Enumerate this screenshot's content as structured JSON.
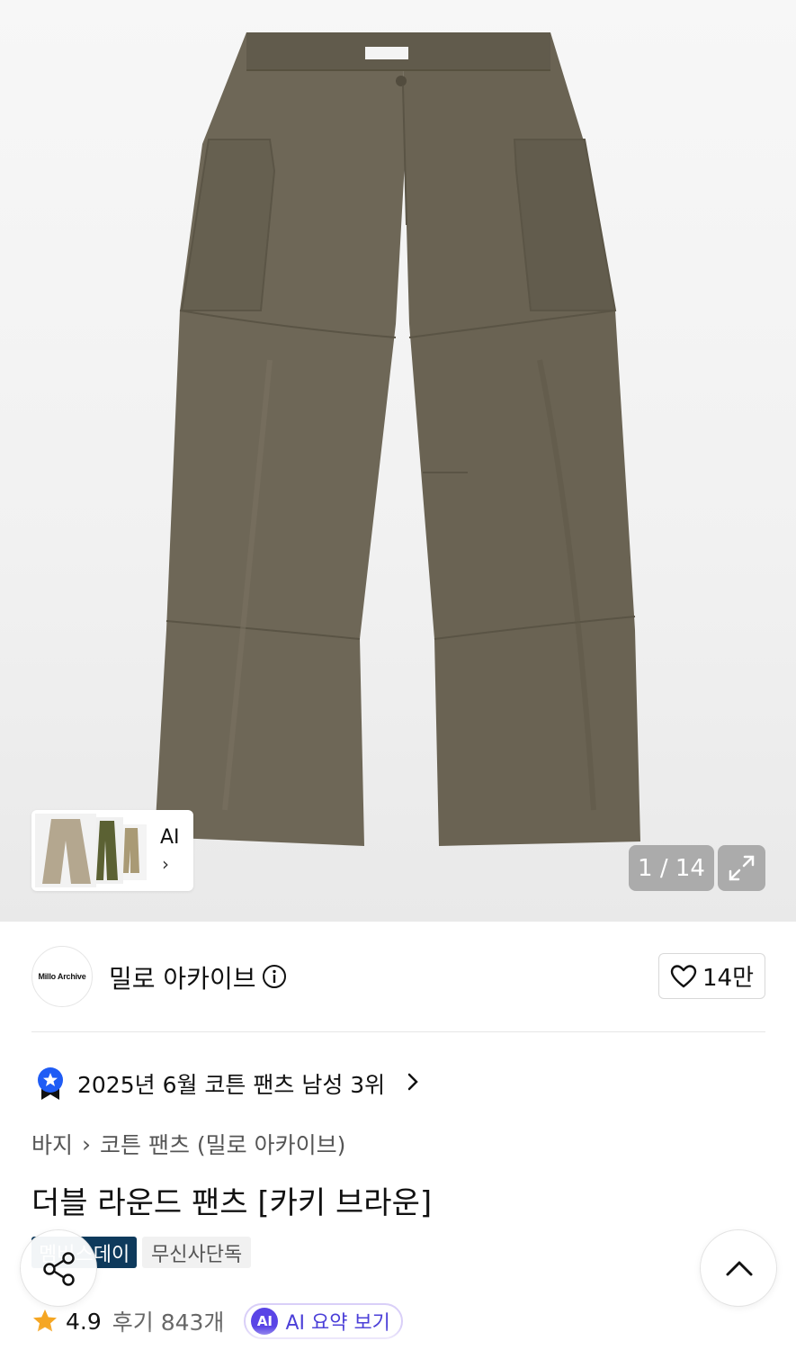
{
  "gallery": {
    "counter": "1 / 14",
    "thumb_label": "AI",
    "thumb_chevron": "›"
  },
  "brand": {
    "logo_text": "Millo Archive",
    "name": "밀로 아카이브",
    "likes": "14만"
  },
  "ranking": {
    "text": "2025년 6월 코튼 팬츠 남성 3위"
  },
  "breadcrumb": {
    "level1": "바지",
    "separator": "›",
    "level2": "코튼 팬츠 (밀로 아카이브)"
  },
  "product": {
    "title": "더블 라운드 팬츠 [카키 브라운]"
  },
  "tags": {
    "first": "멤버스데이",
    "second": "무신사단독"
  },
  "rating": {
    "value": "4.9",
    "reviews": "후기 843개",
    "ai_chip": "AI",
    "ai_summary": "AI 요약 보기"
  },
  "colors": {
    "pants": "#6e6757",
    "tag_dark": "#0e3a5c",
    "ai_purple": "#5a45e6",
    "rank_badge": "#1f5cf5"
  }
}
